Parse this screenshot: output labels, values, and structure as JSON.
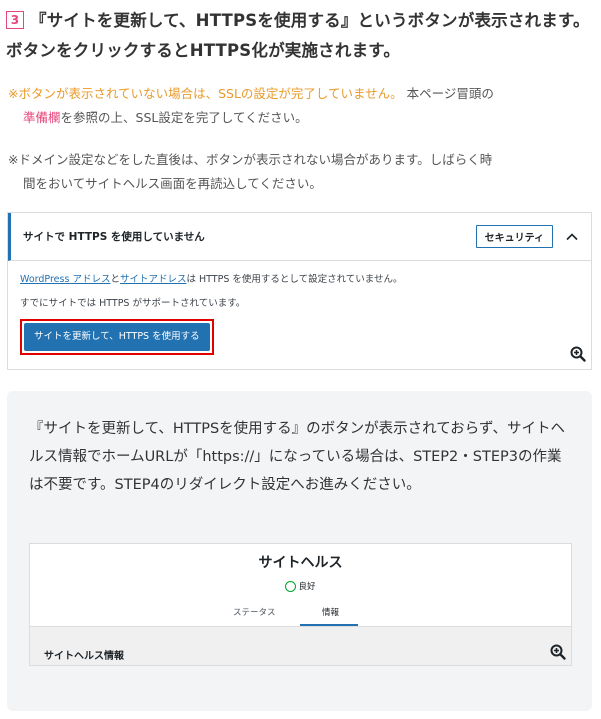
{
  "heading": {
    "step_number": "3",
    "text": "『サイトを更新して、HTTPSを使用する』というボタンが表示されます。ボタンをクリックするとHTTPS化が実施されます。"
  },
  "note1": {
    "highlight": "※ボタンが表示されていない場合は、SSLの設定が完了していません。",
    "text_before_link": "本ページ冒頭の",
    "link": "準備欄",
    "text_after_link": "を参照の上、SSL設定を完了してください。"
  },
  "note2": {
    "line1": "※ドメイン設定などをした直後は、ボタンが表示されない場合があります。しばらく時",
    "line2": "間をおいてサイトヘルス画面を再読込してください。"
  },
  "screenshot1": {
    "title": "サイトで HTTPS を使用していません",
    "badge": "セキュリティ",
    "link_wp_address": "WordPress アドレス",
    "and": "と",
    "link_site_address": "サイトアドレス",
    "line1_rest": "は HTTPS を使用するとして設定されていません。",
    "line2": "すでにサイトでは HTTPS がサポートされています。",
    "button": "サイトを更新して、HTTPS を使用する"
  },
  "info_box": {
    "text": "『サイトを更新して、HTTPSを使用する』のボタンが表示されておらず、サイトヘルス情報でホームURLが「https://」になっている場合は、STEP2・STEP3の作業は不要です。STEP4のリダイレクト設定へお進みください。"
  },
  "screenshot2": {
    "title": "サイトヘルス",
    "status": "良好",
    "tabs": [
      "ステータス",
      "情報"
    ],
    "section": "サイトヘルス情報"
  },
  "colors": {
    "accent_pink": "#e8457a",
    "warning_orange": "#e99a2a",
    "wp_blue": "#2271b1",
    "highlight_red": "#e00000"
  }
}
